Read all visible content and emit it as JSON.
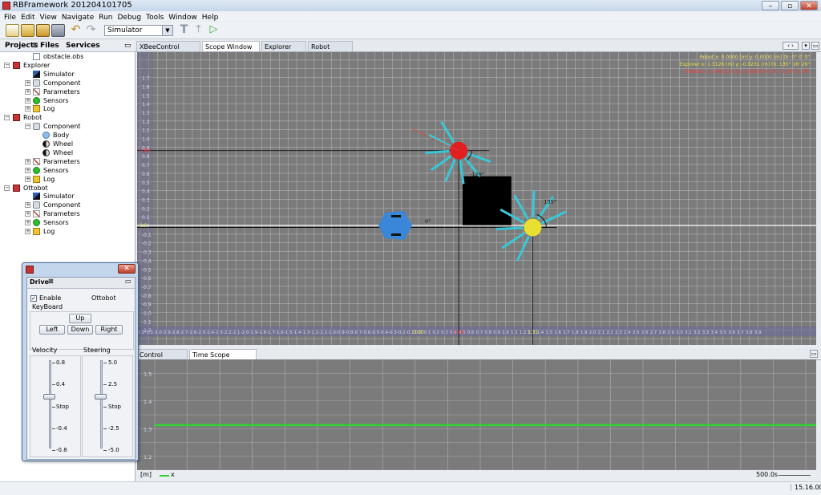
{
  "window": {
    "title": "RBFramework 201204101705",
    "buttons": [
      "–",
      "▫",
      "✕"
    ]
  },
  "menu": [
    "File",
    "Edit",
    "View",
    "Navigate",
    "Run",
    "Debug",
    "Tools",
    "Window",
    "Help"
  ],
  "toolbar": {
    "mode_select": "Simulator"
  },
  "left_panel": {
    "tabs": [
      "Projects",
      "Files",
      "Services"
    ],
    "tree": [
      {
        "label": "obstacle.obs",
        "depth": 1,
        "icon": "file-icon",
        "exp": ""
      },
      {
        "label": "Explorer",
        "depth": 0,
        "icon": "robot-icon",
        "exp": "−"
      },
      {
        "label": "Simulator",
        "depth": 1,
        "icon": "simulator-icon",
        "exp": ""
      },
      {
        "label": "Component",
        "depth": 1,
        "icon": "component-icon",
        "exp": "+"
      },
      {
        "label": "Parameters",
        "depth": 1,
        "icon": "parameters-icon",
        "exp": "+"
      },
      {
        "label": "Sensors",
        "depth": 1,
        "icon": "sensors-icon",
        "exp": "+"
      },
      {
        "label": "Log",
        "depth": 1,
        "icon": "log-icon",
        "exp": "+"
      },
      {
        "label": "Robot",
        "depth": 0,
        "icon": "robot-icon",
        "exp": "−"
      },
      {
        "label": "Component",
        "depth": 1,
        "icon": "component-icon",
        "exp": "−"
      },
      {
        "label": "Body",
        "depth": 2,
        "icon": "body-icon",
        "exp": ""
      },
      {
        "label": "Wheel",
        "depth": 2,
        "icon": "wheel-icon",
        "exp": ""
      },
      {
        "label": "Wheel",
        "depth": 2,
        "icon": "wheel-icon",
        "exp": ""
      },
      {
        "label": "Parameters",
        "depth": 1,
        "icon": "parameters-icon",
        "exp": "+"
      },
      {
        "label": "Sensors",
        "depth": 1,
        "icon": "sensors-icon",
        "exp": "+"
      },
      {
        "label": "Log",
        "depth": 1,
        "icon": "log-icon",
        "exp": "+"
      },
      {
        "label": "Ottobot",
        "depth": 0,
        "icon": "robot-icon",
        "exp": "−"
      },
      {
        "label": "Simulator",
        "depth": 1,
        "icon": "simulator-icon",
        "exp": ""
      },
      {
        "label": "Component",
        "depth": 1,
        "icon": "component-icon",
        "exp": "+"
      },
      {
        "label": "Parameters",
        "depth": 1,
        "icon": "parameters-icon",
        "exp": "+"
      },
      {
        "label": "Sensors",
        "depth": 1,
        "icon": "sensors-icon",
        "exp": "+"
      },
      {
        "label": "Log",
        "depth": 1,
        "icon": "log-icon",
        "exp": "+"
      }
    ]
  },
  "editor_tabs": [
    "XBeeControl Window",
    "Scope Window",
    "Explorer Editor",
    "Robot Editor"
  ],
  "scope": {
    "legend": [
      {
        "text": "Robot    x: 0.0000 [m]   y: 0.0000 [m]   th: 0° 0' 0\"",
        "color": "#f0e070"
      },
      {
        "text": "Explorer   x: 1.3126 [m]   y: -0.0231 [m]   th: 135° 16' 26\"",
        "color": "#e8e040"
      },
      {
        "text": "Ottobot   x: 0.4625 [m]   y: 0.8596 [m]   th: -129° 0' 18\"",
        "color": "#ff3a3a"
      }
    ],
    "y_ticks": [
      "1.7",
      "1.6",
      "1.5",
      "1.4",
      "1.3",
      "1.2",
      "1.1",
      "1.0",
      "0.9",
      "0.8",
      "0.7",
      "0.6",
      "0.5",
      "0.4",
      "0.3",
      "0.2",
      "0.1",
      "0.0",
      "-0.1",
      "-0.2",
      "-0.3",
      "-0.4",
      "-0.5",
      "-0.6",
      "-0.7",
      "-0.8",
      "-0.9",
      "-1.0",
      "-1.1",
      "-1.2"
    ],
    "x_ticks": [
      "-3.5",
      "-3.4",
      "-3.3",
      "-3.2",
      "-3.1",
      "-3.0",
      "-2.9",
      "-2.8",
      "-2.7",
      "-2.6",
      "-2.5",
      "-2.4",
      "-2.3",
      "-2.2",
      "-2.1",
      "-2.0",
      "-1.9",
      "-1.8",
      "-1.7",
      "-1.6",
      "-1.5",
      "-1.4",
      "-1.3",
      "-1.2",
      "-1.1",
      "-1.0",
      "-0.9",
      "-0.8",
      "-0.7",
      "-0.6",
      "-0.5",
      "-0.4",
      "-0.3",
      "-0.2",
      "-0.1",
      "0.0",
      "0.1",
      "0.2",
      "0.3",
      "0.4",
      "0.5",
      "0.6",
      "0.7",
      "0.8",
      "0.9",
      "1.0",
      "1.1",
      "1.2",
      "1.3",
      "1.4",
      "1.5",
      "1.6",
      "1.7",
      "1.8",
      "1.9",
      "2.0",
      "2.1",
      "2.2",
      "2.3",
      "2.4",
      "2.5",
      "2.6",
      "2.7",
      "2.8",
      "2.9",
      "3.0",
      "3.1",
      "3.2",
      "3.3",
      "3.4",
      "3.5",
      "3.6",
      "3.7",
      "3.8",
      "3.9"
    ],
    "markers": {
      "y_robot": "0.86",
      "y_zero": "0.0",
      "x_robot": "0.00",
      "x_ottobot": "0.46",
      "x_explorer": "1.31"
    },
    "angle_labels": {
      "ottobot": "-129°",
      "explorer": "135°",
      "robot": "0°"
    },
    "colors": {
      "background": "#7b7b7b",
      "grid": "#b0b0b0",
      "ottobot": "#e02020",
      "explorer": "#e8e030",
      "robot": "#3a86d8",
      "rays": "#38c8d8",
      "obstacle": "#000000"
    }
  },
  "bottom_tabs": [
    "Control Window",
    "Time Scope Window"
  ],
  "time_scope": {
    "y_ticks": [
      "1.5",
      "1.4",
      "1.3",
      "1.2"
    ],
    "line_color": "#2ed52e",
    "unit": "[m]",
    "legend": "x",
    "time_label": "500.0s",
    "chart_data": {
      "type": "line",
      "series": [
        {
          "name": "x",
          "values": [
            1.3126,
            1.3126
          ]
        }
      ],
      "ylim": [
        1.15,
        1.55
      ]
    }
  },
  "status": {
    "right": "15.16.00"
  },
  "drive": {
    "tab": "Drive",
    "enable_label": "Enable",
    "enabled": true,
    "robot_name": "Ottobot",
    "keyboard_label": "KeyBoard",
    "up": "Up",
    "left": "Left",
    "down": "Down",
    "right": "Right",
    "velocity_label": "Velocity",
    "steering_label": "Steering",
    "velocity_ticks": [
      "0.8",
      "0.4",
      "Stop",
      "-0.4",
      "-0.8"
    ],
    "steering_ticks": [
      "5.0",
      "2.5",
      "Stop",
      "-2.5",
      "-5.0"
    ]
  }
}
